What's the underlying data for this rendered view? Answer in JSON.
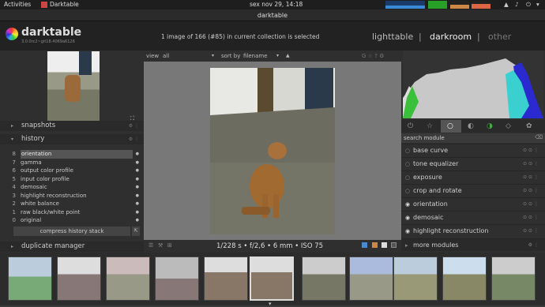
{
  "topbar": {
    "activities": "Activities",
    "app": "Darktable",
    "clock": "sex nov 29, 14:18"
  },
  "window": {
    "title": "darktable"
  },
  "header": {
    "logo": "darktable",
    "version": "3.0.0rc2~git18.4069a6126",
    "info": "1 image of 166 (#85) in current collection is selected",
    "views": [
      "lighttable",
      "|",
      "darkroom",
      "|",
      "other"
    ]
  },
  "toolbar": {
    "view_label": "view",
    "view_value": "all",
    "sort_label": "sort by",
    "sort_value": "filename",
    "icons_right": "G ☆ ? ⚙"
  },
  "left": {
    "snapshots": "snapshots",
    "history": "history",
    "history_items": [
      {
        "n": "8",
        "label": "orientation"
      },
      {
        "n": "7",
        "label": "gamma"
      },
      {
        "n": "6",
        "label": "output color profile"
      },
      {
        "n": "5",
        "label": "input color profile"
      },
      {
        "n": "4",
        "label": "demosaic"
      },
      {
        "n": "3",
        "label": "highlight reconstruction"
      },
      {
        "n": "2",
        "label": "white balance"
      },
      {
        "n": "1",
        "label": "raw black/white point"
      },
      {
        "n": "0",
        "label": "original"
      }
    ],
    "compress": "compress history stack",
    "duplicate": "duplicate manager"
  },
  "center": {
    "exif": "1/228 s • f/2,6 • 6 mm • ISO 75"
  },
  "right": {
    "search_label": "search module",
    "modules": [
      "base curve",
      "tone equalizer",
      "exposure",
      "crop and rotate",
      "orientation",
      "demosaic",
      "highlight reconstruction"
    ],
    "more": "more modules"
  },
  "colors": {
    "accent": "#e8e8e8",
    "bg": "#3a3a3a",
    "panel": "#2f2f2f"
  }
}
